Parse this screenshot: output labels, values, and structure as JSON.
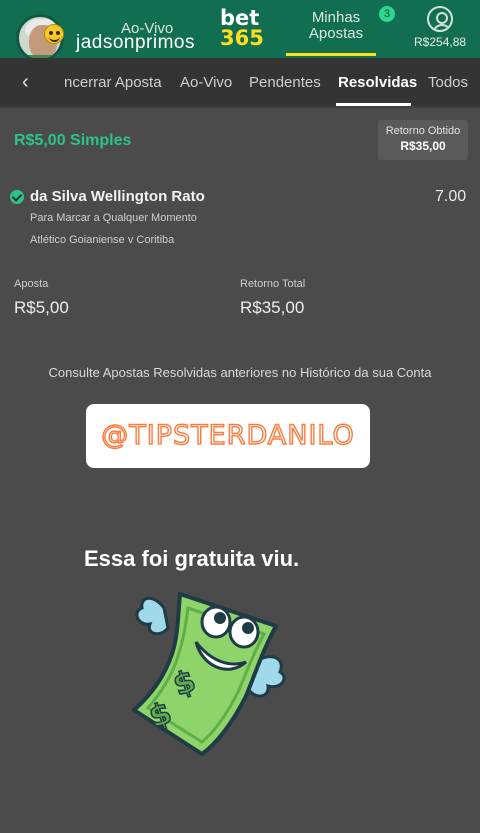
{
  "header": {
    "ao_vivo": "Ao-Vivo",
    "username": "jadsonprimos",
    "brand_top": "bet",
    "brand_bottom": "365",
    "minhas_apostas": "Minhas Apostas",
    "badge_count": "3",
    "balance": "R$254,88",
    "icons": [
      "avatar",
      "smile-emoji-icon",
      "user-account-icon"
    ]
  },
  "tabs": {
    "back_icon": "‹",
    "items": [
      "ncerrar Aposta",
      "Ao-Vivo",
      "Pendentes",
      "Resolvidas",
      "Todos"
    ],
    "active": "Resolvidas"
  },
  "bet": {
    "stake_title": "R$5,00 Simples",
    "retorno_label": "Retorno Obtido",
    "retorno_value": "R$35,00",
    "selection": "da Silva Wellington Rato",
    "odds": "7.00",
    "market": "Para Marcar a Qualquer Momento",
    "event": "Atlético Goianiense v Coritiba",
    "aposta_label": "Aposta",
    "aposta_value": "R$5,00",
    "total_label": "Retorno Total",
    "total_value": "R$35,00"
  },
  "history_note": "Consulte Apostas Resolvidas anteriores no Histórico da sua Conta",
  "overlay": {
    "tipster_tag": "@TIPSTERDANILO",
    "caption": "Essa foi gratuita viu."
  },
  "colors": {
    "header_green": "#126e51",
    "accent_green": "#2bc489",
    "brand_yellow": "#ffdf1b",
    "background": "#4b4b4b",
    "tipster_orange": "#ff7a3a"
  }
}
